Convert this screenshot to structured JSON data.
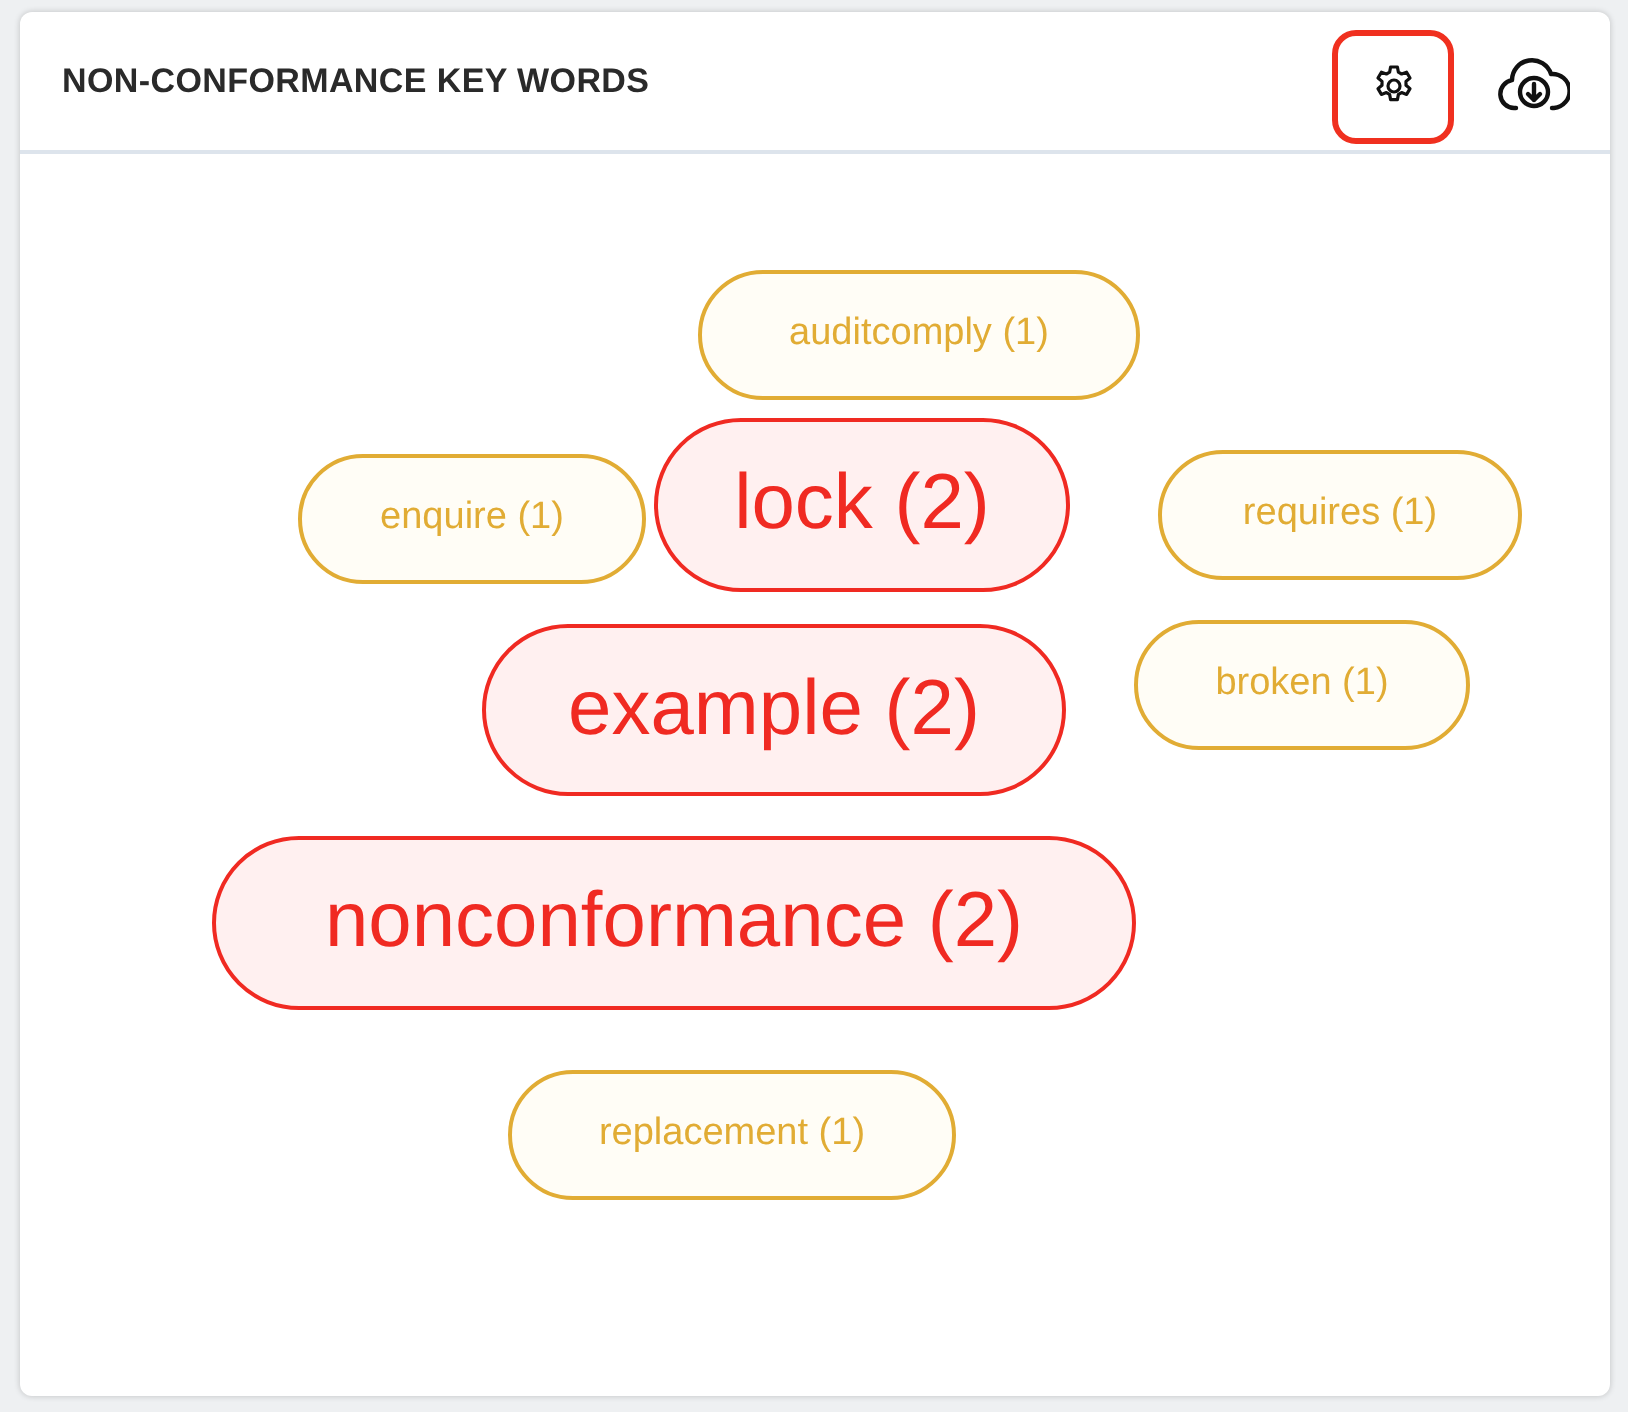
{
  "panel": {
    "title": "NON-CONFORMANCE KEY WORDS"
  },
  "settings_button": {
    "focused": true
  },
  "keywords": [
    {
      "label": "auditcomply (1)",
      "kind": "low"
    },
    {
      "label": "enquire (1)",
      "kind": "low"
    },
    {
      "label": "lock (2)",
      "kind": "high"
    },
    {
      "label": "requires (1)",
      "kind": "low"
    },
    {
      "label": "broken (1)",
      "kind": "low"
    },
    {
      "label": "example (2)",
      "kind": "high"
    },
    {
      "label": "nonconformance (2)",
      "kind": "high"
    },
    {
      "label": "replacement (1)",
      "kind": "low"
    }
  ]
}
